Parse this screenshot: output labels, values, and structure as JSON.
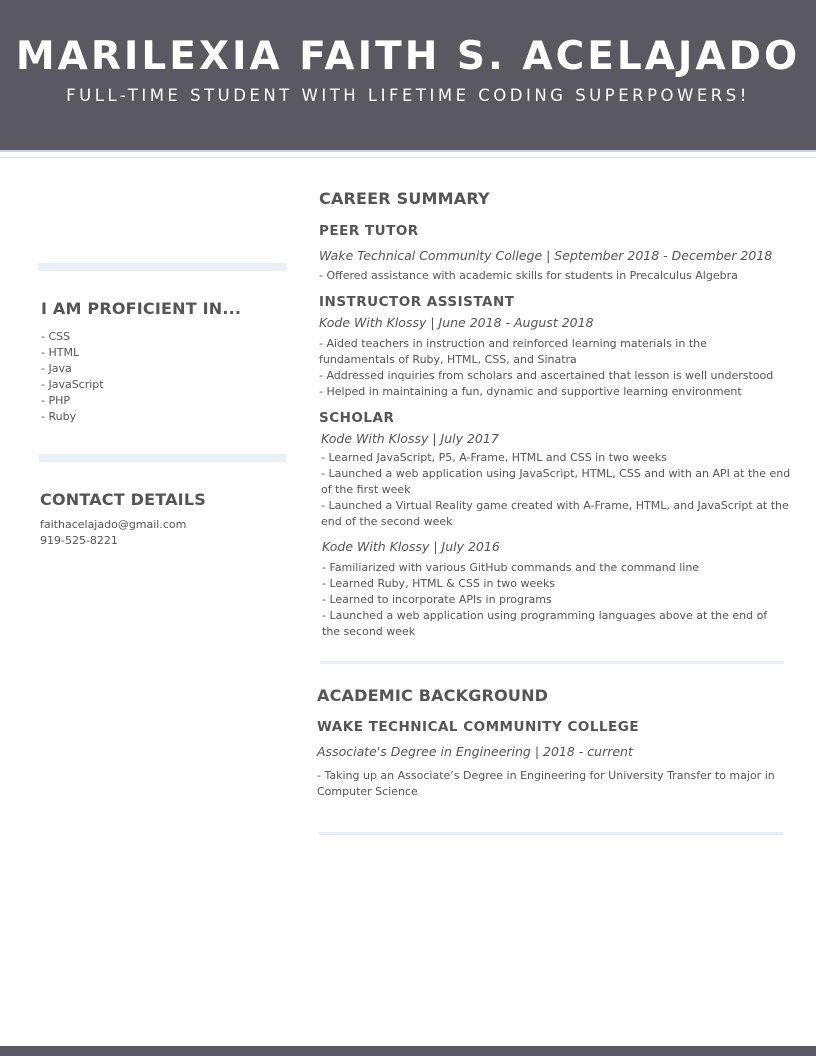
{
  "header": {
    "name": "MARILEXIA FAITH S. ACELAJADO",
    "tagline": "FULL-TIME STUDENT WITH LIFETIME CODING SUPERPOWERS!"
  },
  "sidebar": {
    "skills": {
      "title": "I AM PROFICIENT IN...",
      "items": [
        "- CSS",
        "- HTML",
        "- Java",
        "- JavaScript",
        "- PHP",
        "- Ruby"
      ]
    },
    "contact": {
      "title": "CONTACT DETAILS",
      "email": "faithacelajado@gmail.com",
      "phone": "919-525-8221"
    }
  },
  "career": {
    "title": "CAREER SUMMARY",
    "jobs": [
      {
        "role": "PEER TUTOR",
        "org": "Wake Technical Community College | September 2018 - December 2018",
        "bullets": [
          "- Offered assistance with academic skills for students in Precalculus Algebra"
        ]
      },
      {
        "role": "INSTRUCTOR ASSISTANT",
        "org": "Kode With Klossy | June 2018 - August 2018",
        "bullets": [
          "- Aided teachers in instruction and reinforced learning materials in the fundamentals of Ruby, HTML, CSS, and Sinatra",
          "- Addressed inquiries from scholars and ascertained that lesson is well understood",
          "- Helped in maintaining a fun, dynamic and supportive learning environment"
        ]
      },
      {
        "role": "SCHOLAR",
        "org": "Kode With Klossy | July 2017",
        "bullets": [
          "- Learned JavaScript, P5, A-Frame, HTML and CSS in two weeks",
          "- Launched a web application using JavaScript, HTML, CSS and with an API at the end of the first week",
          "- Launched a Virtual Reality game created with A-Frame, HTML, and JavaScript at the end of the second week"
        ]
      },
      {
        "org": "Kode With Klossy | July 2016",
        "bullets": [
          "- Familiarized with various GitHub commands and the command line",
          "- Learned Ruby, HTML & CSS in two weeks",
          "- Learned to incorporate APIs in programs",
          "- Launched a web application using programming languages above at the end of the second week"
        ]
      }
    ]
  },
  "academic": {
    "title": "ACADEMIC BACKGROUND",
    "school": "WAKE TECHNICAL COMMUNITY COLLEGE",
    "degree": "Associate's Degree in Engineering | 2018 -  current",
    "description": "- Taking up an Associate’s Degree in Engineering for University Transfer to major in Computer Science"
  }
}
